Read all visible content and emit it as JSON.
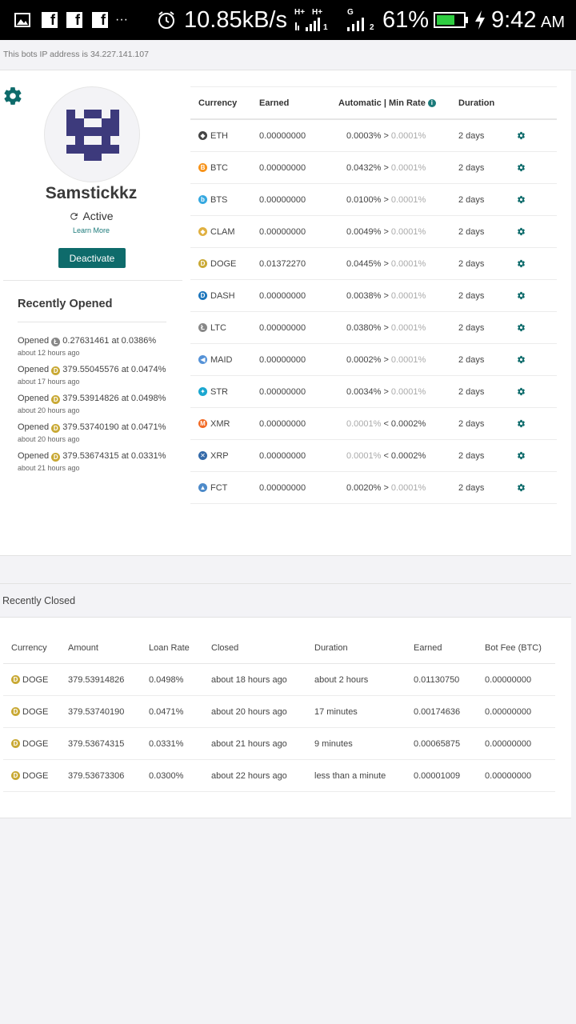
{
  "status_bar": {
    "speed": "10.85kB/s",
    "network_label_1": "H+",
    "network_label_2": "H+",
    "sim1": "1",
    "sim2": "2",
    "network_g": "G",
    "battery": "61%",
    "time": "9:42",
    "ampm": "AM",
    "dots": "···"
  },
  "ip_notice": "This bots IP address is 34.227.141.107",
  "profile": {
    "username": "Samstickkz",
    "status": "Active",
    "learn_more": "Learn More",
    "deactivate_label": "Deactivate"
  },
  "recently_opened": {
    "title": "Recently Opened",
    "items": [
      {
        "prefix": "Opened",
        "coin": "LTC",
        "text": "0.27631461 at 0.0386%",
        "time": "about 12 hours ago"
      },
      {
        "prefix": "Opened",
        "coin": "DOGE",
        "text": "379.55045576 at 0.0474%",
        "time": "about 17 hours ago"
      },
      {
        "prefix": "Opened",
        "coin": "DOGE",
        "text": "379.53914826 at 0.0498%",
        "time": "about 20 hours ago"
      },
      {
        "prefix": "Opened",
        "coin": "DOGE",
        "text": "379.53740190 at 0.0471%",
        "time": "about 20 hours ago"
      },
      {
        "prefix": "Opened",
        "coin": "DOGE",
        "text": "379.53674315 at 0.0331%",
        "time": "about 21 hours ago"
      }
    ]
  },
  "lending": {
    "headers": {
      "currency": "Currency",
      "earned": "Earned",
      "rate": "Automatic | Min Rate",
      "duration": "Duration"
    },
    "rows": [
      {
        "currency": "ETH",
        "earned": "0.00000000",
        "rate_a": "0.0003%",
        "op": ">",
        "rate_b": "0.0001%",
        "a_muted": false,
        "duration": "2 days"
      },
      {
        "currency": "BTC",
        "earned": "0.00000000",
        "rate_a": "0.0432%",
        "op": ">",
        "rate_b": "0.0001%",
        "a_muted": false,
        "duration": "2 days"
      },
      {
        "currency": "BTS",
        "earned": "0.00000000",
        "rate_a": "0.0100%",
        "op": ">",
        "rate_b": "0.0001%",
        "a_muted": false,
        "duration": "2 days"
      },
      {
        "currency": "CLAM",
        "earned": "0.00000000",
        "rate_a": "0.0049%",
        "op": ">",
        "rate_b": "0.0001%",
        "a_muted": false,
        "duration": "2 days"
      },
      {
        "currency": "DOGE",
        "earned": "0.01372270",
        "rate_a": "0.0445%",
        "op": ">",
        "rate_b": "0.0001%",
        "a_muted": false,
        "duration": "2 days"
      },
      {
        "currency": "DASH",
        "earned": "0.00000000",
        "rate_a": "0.0038%",
        "op": ">",
        "rate_b": "0.0001%",
        "a_muted": false,
        "duration": "2 days"
      },
      {
        "currency": "LTC",
        "earned": "0.00000000",
        "rate_a": "0.0380%",
        "op": ">",
        "rate_b": "0.0001%",
        "a_muted": false,
        "duration": "2 days"
      },
      {
        "currency": "MAID",
        "earned": "0.00000000",
        "rate_a": "0.0002%",
        "op": ">",
        "rate_b": "0.0001%",
        "a_muted": false,
        "duration": "2 days"
      },
      {
        "currency": "STR",
        "earned": "0.00000000",
        "rate_a": "0.0034%",
        "op": ">",
        "rate_b": "0.0001%",
        "a_muted": false,
        "duration": "2 days"
      },
      {
        "currency": "XMR",
        "earned": "0.00000000",
        "rate_a": "0.0001%",
        "op": "<",
        "rate_b": "0.0002%",
        "a_muted": true,
        "duration": "2 days"
      },
      {
        "currency": "XRP",
        "earned": "0.00000000",
        "rate_a": "0.0001%",
        "op": "<",
        "rate_b": "0.0002%",
        "a_muted": true,
        "duration": "2 days"
      },
      {
        "currency": "FCT",
        "earned": "0.00000000",
        "rate_a": "0.0020%",
        "op": ">",
        "rate_b": "0.0001%",
        "a_muted": false,
        "duration": "2 days"
      }
    ]
  },
  "recently_closed": {
    "title": "Recently Closed",
    "headers": {
      "currency": "Currency",
      "amount": "Amount",
      "loan_rate": "Loan Rate",
      "closed": "Closed",
      "duration": "Duration",
      "earned": "Earned",
      "bot_fee": "Bot Fee (BTC)"
    },
    "rows": [
      {
        "currency": "DOGE",
        "amount": "379.53914826",
        "loan_rate": "0.0498%",
        "closed": "about 18 hours ago",
        "duration": "about 2 hours",
        "earned": "0.01130750",
        "bot_fee": "0.00000000"
      },
      {
        "currency": "DOGE",
        "amount": "379.53740190",
        "loan_rate": "0.0471%",
        "closed": "about 20 hours ago",
        "duration": "17 minutes",
        "earned": "0.00174636",
        "bot_fee": "0.00000000"
      },
      {
        "currency": "DOGE",
        "amount": "379.53674315",
        "loan_rate": "0.0331%",
        "closed": "about 21 hours ago",
        "duration": "9 minutes",
        "earned": "0.00065875",
        "bot_fee": "0.00000000"
      },
      {
        "currency": "DOGE",
        "amount": "379.53673306",
        "loan_rate": "0.0300%",
        "closed": "about 22 hours ago",
        "duration": "less than a minute",
        "earned": "0.00001009",
        "bot_fee": "0.00000000"
      }
    ]
  },
  "coin_colors": {
    "ETH": "#444444",
    "BTC": "#f7931a",
    "BTS": "#35a8e0",
    "CLAM": "#e0b040",
    "DOGE": "#c9a935",
    "DASH": "#1c75bc",
    "LTC": "#888888",
    "MAID": "#5592d7",
    "STR": "#1aa7d0",
    "XMR": "#f26822",
    "XRP": "#346aa9",
    "FCT": "#4d8ac9"
  },
  "coin_glyphs": {
    "ETH": "◆",
    "BTC": "B",
    "BTS": "b",
    "CLAM": "◆",
    "DOGE": "D",
    "DASH": "D",
    "LTC": "Ł",
    "MAID": "◀",
    "STR": "✦",
    "XMR": "M",
    "XRP": "✕",
    "FCT": "▲"
  },
  "accent_color": "#0e6b6b"
}
